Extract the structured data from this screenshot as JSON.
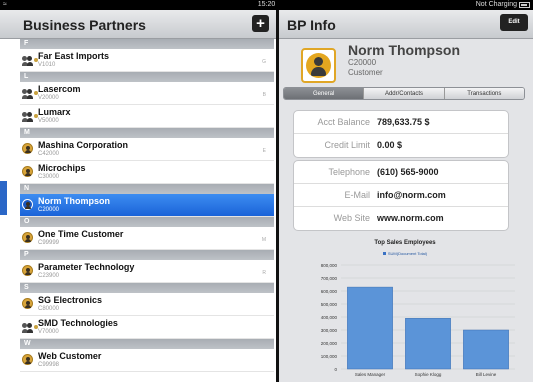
{
  "status_bar": {
    "time": "15:20",
    "battery_text": "Not Charging"
  },
  "left_panel": {
    "title": "Business Partners",
    "add_label": "+",
    "sections": [
      {
        "letter": "F",
        "rows": [
          {
            "name": "Far East Imports",
            "code": "V1010",
            "icon": "group-icon",
            "idx": "G"
          }
        ]
      },
      {
        "letter": "L",
        "rows": [
          {
            "name": "Lasercom",
            "code": "V20000",
            "icon": "group-icon",
            "idx": "B"
          },
          {
            "name": "Lumarx",
            "code": "V50000",
            "icon": "group-icon",
            "idx": ""
          }
        ]
      },
      {
        "letter": "M",
        "rows": [
          {
            "name": "Mashina Corporation",
            "code": "C42000",
            "icon": "person-icon",
            "idx": "E"
          },
          {
            "name": "Microchips",
            "code": "C30000",
            "icon": "person-icon",
            "idx": ""
          }
        ]
      },
      {
        "letter": "N",
        "rows": [
          {
            "name": "Norm Thompson",
            "code": "C20000",
            "icon": "person-icon",
            "idx": "",
            "selected": true
          }
        ]
      },
      {
        "letter": "O",
        "rows": [
          {
            "name": "One Time Customer",
            "code": "C99999",
            "icon": "person-icon",
            "idx": "M"
          }
        ]
      },
      {
        "letter": "P",
        "rows": [
          {
            "name": "Parameter Technology",
            "code": "C23900",
            "icon": "person-icon",
            "idx": "R"
          }
        ]
      },
      {
        "letter": "S",
        "rows": [
          {
            "name": "SG Electronics",
            "code": "C80000",
            "icon": "person-icon",
            "idx": ""
          },
          {
            "name": "SMD Technologies",
            "code": "V70000",
            "icon": "group-icon",
            "idx": ""
          }
        ]
      },
      {
        "letter": "W",
        "rows": [
          {
            "name": "Web Customer",
            "code": "C99998",
            "icon": "person-icon",
            "idx": ""
          }
        ]
      }
    ]
  },
  "right_panel": {
    "title": "BP Info",
    "edit_label": "Edit",
    "bp": {
      "name": "Norm Thompson",
      "code": "C20000",
      "type": "Customer"
    },
    "tabs": [
      {
        "label": "General",
        "active": true
      },
      {
        "label": "Addr/Contacts"
      },
      {
        "label": "Transactions"
      }
    ],
    "balance": {
      "acct_label": "Acct Balance",
      "acct_value": "789,633.75 $",
      "limit_label": "Credit Limit",
      "limit_value": "0.00 $"
    },
    "contact": {
      "phone_label": "Telephone",
      "phone_value": "(610) 565-9000",
      "email_label": "E-Mail",
      "email_value": "info@norm.com",
      "web_label": "Web Site",
      "web_value": "www.norm.com"
    }
  },
  "chart_data": {
    "type": "bar",
    "title": "Top Sales Employees",
    "series": [
      {
        "name": "SUM(Document Total)",
        "values": [
          630000,
          390000,
          300000
        ]
      }
    ],
    "categories": [
      "Sales Manager",
      "Sophie Klogg",
      "Bill Levine"
    ],
    "yticks": [
      "0",
      "100,000",
      "200,000",
      "300,000",
      "400,000",
      "500,000",
      "600,000",
      "700,000",
      "800,000"
    ],
    "ylim": [
      0,
      800000
    ],
    "bar_color": "#5b94d8"
  }
}
